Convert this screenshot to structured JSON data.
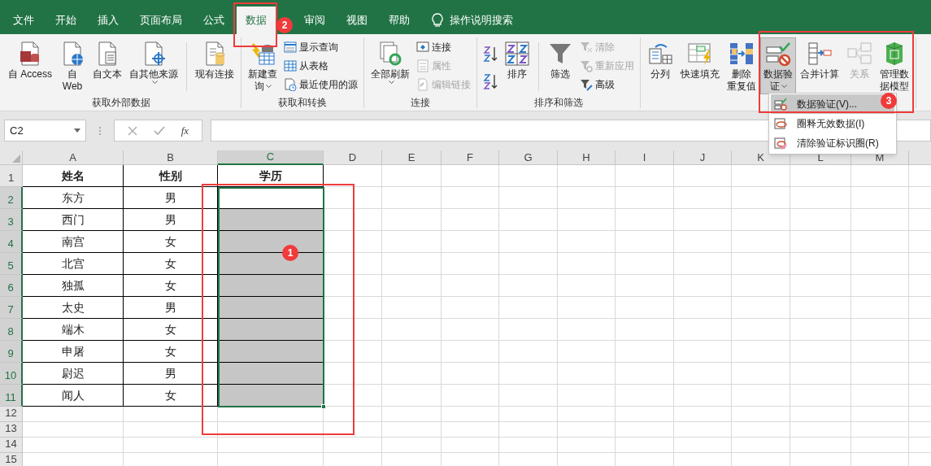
{
  "ribbon_tabs": [
    {
      "label": "文件",
      "selected": false
    },
    {
      "label": "开始",
      "selected": false
    },
    {
      "label": "插入",
      "selected": false
    },
    {
      "label": "页面布局",
      "selected": false
    },
    {
      "label": "公式",
      "selected": false
    },
    {
      "label": "数据",
      "selected": true
    },
    {
      "label": "审阅",
      "selected": false
    },
    {
      "label": "视图",
      "selected": false
    },
    {
      "label": "帮助",
      "selected": false
    }
  ],
  "search": {
    "label": "操作说明搜索"
  },
  "ribbon_groups": [
    {
      "label": "获取外部数据",
      "controls": [
        {
          "kind": "large",
          "lines": [
            "自 Access"
          ],
          "dropdown": false,
          "disabled": false,
          "pressed": false
        },
        {
          "kind": "large",
          "lines": [
            "自",
            "Web"
          ],
          "dropdown": false,
          "disabled": false,
          "pressed": false
        },
        {
          "kind": "large",
          "lines": [
            "自文本"
          ],
          "dropdown": false,
          "disabled": false,
          "pressed": false
        },
        {
          "kind": "large",
          "lines": [
            "自其他来源"
          ],
          "dropdown": true,
          "disabled": false,
          "pressed": false
        },
        {
          "kind": "separator"
        },
        {
          "kind": "large",
          "lines": [
            "现有连接"
          ],
          "dropdown": false,
          "disabled": false,
          "pressed": false
        }
      ]
    },
    {
      "label": "获取和转换",
      "controls": [
        {
          "kind": "large",
          "lines": [
            "新建查",
            "询"
          ],
          "dropdown": true,
          "disabled": false,
          "pressed": false
        },
        {
          "kind": "stack",
          "items": [
            {
              "label": "显示查询",
              "disabled": false
            },
            {
              "label": "从表格",
              "disabled": false
            },
            {
              "label": "最近使用的源",
              "disabled": false
            }
          ]
        }
      ]
    },
    {
      "label": "连接",
      "controls": [
        {
          "kind": "large",
          "lines": [
            "全部刷新"
          ],
          "dropdown": true,
          "disabled": false,
          "pressed": false
        },
        {
          "kind": "stack",
          "items": [
            {
              "label": "连接",
              "disabled": false
            },
            {
              "label": "属性",
              "disabled": true
            },
            {
              "label": "编辑链接",
              "disabled": true
            }
          ]
        }
      ]
    },
    {
      "label": "排序和筛选",
      "controls": [
        {
          "kind": "sort_icons"
        },
        {
          "kind": "large",
          "lines": [
            "排序"
          ],
          "dropdown": false,
          "disabled": false,
          "pressed": false
        },
        {
          "kind": "separator"
        },
        {
          "kind": "large",
          "lines": [
            "筛选"
          ],
          "dropdown": false,
          "disabled": false,
          "pressed": false
        },
        {
          "kind": "stack",
          "items": [
            {
              "label": "清除",
              "disabled": true
            },
            {
              "label": "重新应用",
              "disabled": true
            },
            {
              "label": "高级",
              "disabled": false
            }
          ]
        }
      ]
    },
    {
      "controls": [
        {
          "kind": "large",
          "lines": [
            "分列"
          ],
          "dropdown": false,
          "disabled": false,
          "pressed": false
        },
        {
          "kind": "large",
          "lines": [
            "快速填充"
          ],
          "dropdown": false,
          "disabled": false,
          "pressed": false
        },
        {
          "kind": "large",
          "lines": [
            "删除",
            "重复值"
          ],
          "dropdown": false,
          "disabled": false,
          "pressed": false
        },
        {
          "kind": "large",
          "lines": [
            "数据验",
            "证"
          ],
          "dropdown": true,
          "disabled": false,
          "pressed": true
        },
        {
          "kind": "large",
          "lines": [
            "合并计算"
          ],
          "dropdown": false,
          "disabled": false,
          "pressed": false
        },
        {
          "kind": "large",
          "lines": [
            "关系"
          ],
          "dropdown": false,
          "disabled": true,
          "pressed": false
        },
        {
          "kind": "large",
          "lines": [
            "管理数",
            "据模型"
          ],
          "dropdown": false,
          "disabled": false,
          "pressed": false
        }
      ]
    }
  ],
  "dropdown_menu": [
    {
      "label": "数据验证(V)...",
      "selected": true
    },
    {
      "label": "圈释无效数据(I)",
      "selected": false
    },
    {
      "label": "清除验证标识圈(R)",
      "selected": false
    }
  ],
  "formula_bar": {
    "name_box": "C2",
    "function_label": "fx"
  },
  "sheet": {
    "columns": [
      {
        "label": "A",
        "selected": false
      },
      {
        "label": "B",
        "selected": false
      },
      {
        "label": "C",
        "selected": true
      },
      {
        "label": "D",
        "selected": false
      },
      {
        "label": "E",
        "selected": false
      },
      {
        "label": "F",
        "selected": false
      },
      {
        "label": "G",
        "selected": false
      },
      {
        "label": "H",
        "selected": false
      },
      {
        "label": "I",
        "selected": false
      },
      {
        "label": "J",
        "selected": false
      },
      {
        "label": "K",
        "selected": false
      },
      {
        "label": "L",
        "selected": false
      },
      {
        "label": "M",
        "selected": false
      }
    ],
    "rows": [
      {
        "header": "1",
        "kind": "header",
        "selected": false,
        "active": false,
        "cells": [
          "姓名",
          "性别",
          "学历"
        ]
      },
      {
        "header": "2",
        "kind": "data",
        "selected": true,
        "active": true,
        "cells": [
          "东方",
          "男"
        ]
      },
      {
        "header": "3",
        "kind": "data",
        "selected": true,
        "active": false,
        "cells": [
          "西门",
          "男"
        ]
      },
      {
        "header": "4",
        "kind": "data",
        "selected": true,
        "active": false,
        "cells": [
          "南宫",
          "女"
        ]
      },
      {
        "header": "5",
        "kind": "data",
        "selected": true,
        "active": false,
        "cells": [
          "北宫",
          "女"
        ]
      },
      {
        "header": "6",
        "kind": "data",
        "selected": true,
        "active": false,
        "cells": [
          "独孤",
          "女"
        ]
      },
      {
        "header": "7",
        "kind": "data",
        "selected": true,
        "active": false,
        "cells": [
          "太史",
          "男"
        ]
      },
      {
        "header": "8",
        "kind": "data",
        "selected": true,
        "active": false,
        "cells": [
          "端木",
          "女"
        ]
      },
      {
        "header": "9",
        "kind": "data",
        "selected": true,
        "active": false,
        "cells": [
          "申屠",
          "女"
        ]
      },
      {
        "header": "10",
        "kind": "data",
        "selected": true,
        "active": false,
        "cells": [
          "尉迟",
          "男"
        ]
      },
      {
        "header": "11",
        "kind": "data",
        "selected": true,
        "active": false,
        "cells": [
          "闻人",
          "女"
        ]
      },
      {
        "header": "12",
        "kind": "empty",
        "selected": false,
        "active": false
      },
      {
        "header": "13",
        "kind": "empty",
        "selected": false,
        "active": false
      },
      {
        "header": "14",
        "kind": "empty",
        "selected": false,
        "active": false
      },
      {
        "header": "15",
        "kind": "empty",
        "selected": false,
        "active": false
      }
    ]
  },
  "annotations": [
    {
      "number": "1"
    },
    {
      "number": "2"
    },
    {
      "number": "3"
    }
  ]
}
